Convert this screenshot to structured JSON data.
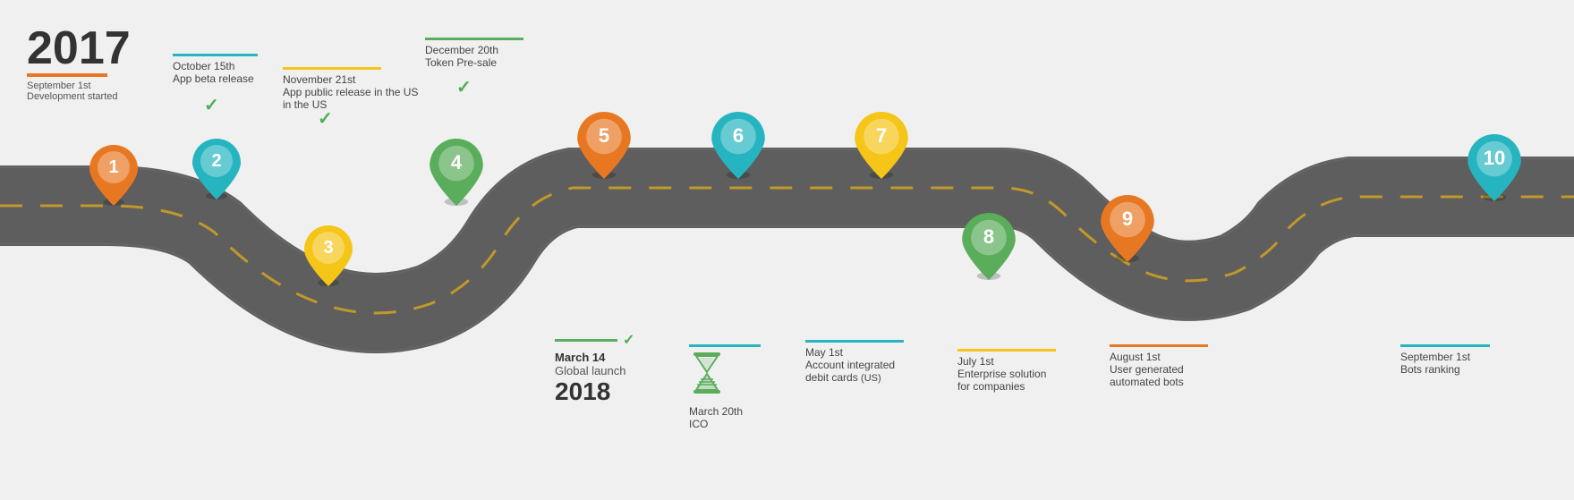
{
  "year": "2017",
  "year_subtitle": "September 1st",
  "year_subtitle2": "Development started",
  "milestones_above": [
    {
      "id": 1,
      "date": "September 1st",
      "event": "Development started",
      "color": "orange",
      "line_color": "orange",
      "checked": false
    },
    {
      "id": 2,
      "date": "October 15th",
      "event": "App beta release",
      "color": "teal",
      "line_color": "teal",
      "checked": true
    },
    {
      "id": 3,
      "date": "November 21st",
      "event": "App public release in the US",
      "color": "yellow",
      "line_color": "yellow",
      "checked": true
    },
    {
      "id": 4,
      "date": "December 20th",
      "event": "Token Pre-sale",
      "color": "green",
      "line_color": "green",
      "checked": true
    },
    {
      "id": 5,
      "date": "",
      "event": "",
      "color": "orange",
      "line_color": "orange",
      "checked": false
    },
    {
      "id": 6,
      "date": "",
      "event": "",
      "color": "teal",
      "line_color": "teal",
      "checked": false
    },
    {
      "id": 7,
      "date": "",
      "event": "",
      "color": "yellow",
      "line_color": "yellow",
      "checked": false
    }
  ],
  "milestones_below": [
    {
      "id": 8,
      "date": "May 1st",
      "event": "Account integrated debit cards (US)",
      "color": "green",
      "line_color": "teal",
      "checked": false
    },
    {
      "id": 9,
      "date": "July 1st",
      "event": "Enterprise solution for companies",
      "color": "orange",
      "line_color": "yellow",
      "checked": false
    },
    {
      "id": 10,
      "date": "September 1st",
      "event": "Bots ranking",
      "color": "teal",
      "line_color": "teal",
      "checked": false
    }
  ],
  "march14": {
    "date": "March 14",
    "year": "2018",
    "event": "Global launch",
    "checked": true
  },
  "march20": {
    "date": "March 20th",
    "event": "ICO",
    "line_color": "teal"
  },
  "august1": {
    "date": "August 1st",
    "event": "User generated automated bots",
    "line_color": "orange"
  }
}
